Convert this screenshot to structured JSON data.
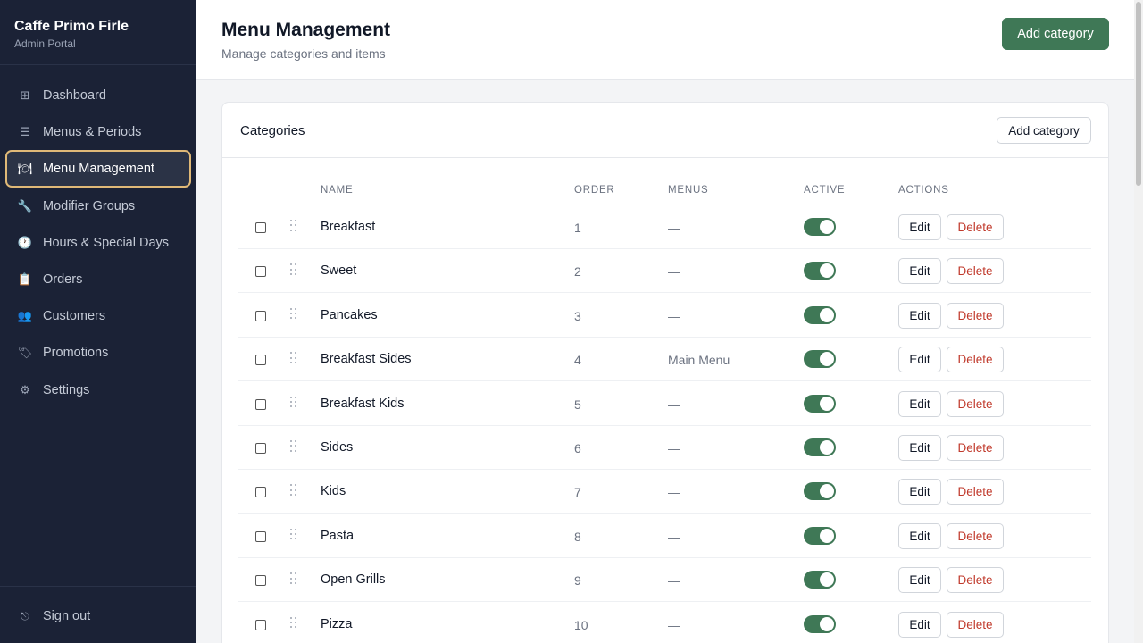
{
  "brand": {
    "name": "Caffe Primo Firle",
    "subtitle": "Admin Portal"
  },
  "sidebar": {
    "items": [
      {
        "label": "Dashboard",
        "icon": "grid-icon",
        "glyph": "⊞",
        "active": false
      },
      {
        "label": "Menus & Periods",
        "icon": "list-icon",
        "glyph": "☰",
        "active": false
      },
      {
        "label": "Menu Management",
        "icon": "plate-icon",
        "glyph": "🍽",
        "active": true
      },
      {
        "label": "Modifier Groups",
        "icon": "wrench-icon",
        "glyph": "🔧",
        "active": false
      },
      {
        "label": "Hours & Special Days",
        "icon": "clock-icon",
        "glyph": "🕐",
        "active": false
      },
      {
        "label": "Orders",
        "icon": "receipt-icon",
        "glyph": "📋",
        "active": false
      },
      {
        "label": "Customers",
        "icon": "users-icon",
        "glyph": "👥",
        "active": false
      },
      {
        "label": "Promotions",
        "icon": "ticket-icon",
        "glyph": "🏷",
        "active": false
      },
      {
        "label": "Settings",
        "icon": "gear-icon",
        "glyph": "⚙",
        "active": false
      }
    ],
    "signout_label": "Sign out",
    "signout_glyph": "⎋"
  },
  "header": {
    "title": "Menu Management",
    "subtitle": "Manage categories and items",
    "primary_button": "Add category"
  },
  "card": {
    "title": "Categories",
    "add_button": "Add category",
    "columns": {
      "name": "Name",
      "order": "Order",
      "menus": "Menus",
      "active": "Active",
      "actions": "Actions"
    },
    "edit_label": "Edit",
    "delete_label": "Delete",
    "rows": [
      {
        "name": "Breakfast",
        "order": "1",
        "menus": "—",
        "active": true
      },
      {
        "name": "Sweet",
        "order": "2",
        "menus": "—",
        "active": true
      },
      {
        "name": "Pancakes",
        "order": "3",
        "menus": "—",
        "active": true
      },
      {
        "name": "Breakfast Sides",
        "order": "4",
        "menus": "Main Menu",
        "active": true
      },
      {
        "name": "Breakfast Kids",
        "order": "5",
        "menus": "—",
        "active": true
      },
      {
        "name": "Sides",
        "order": "6",
        "menus": "—",
        "active": true
      },
      {
        "name": "Kids",
        "order": "7",
        "menus": "—",
        "active": true
      },
      {
        "name": "Pasta",
        "order": "8",
        "menus": "—",
        "active": true
      },
      {
        "name": "Open Grills",
        "order": "9",
        "menus": "—",
        "active": true
      },
      {
        "name": "Pizza",
        "order": "10",
        "menus": "—",
        "active": true
      }
    ]
  },
  "colors": {
    "sidebar_bg": "#1b2236",
    "accent_green": "#3f7856",
    "active_border": "#e0b977",
    "delete_red": "#c0392b"
  }
}
